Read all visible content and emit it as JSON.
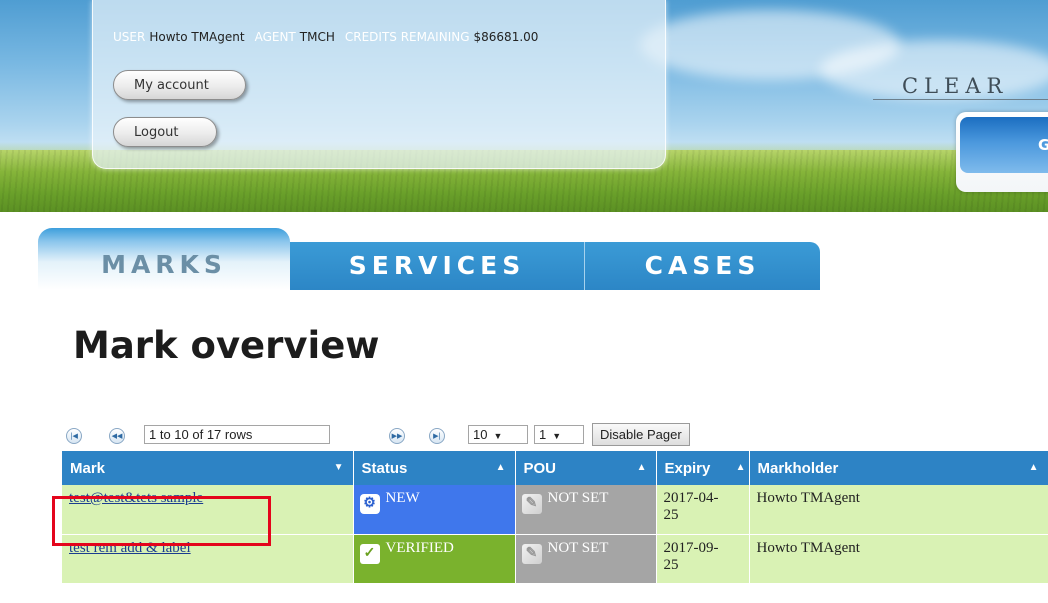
{
  "header": {
    "user_label": "USER",
    "user_value": "Howto TMAgent",
    "agent_label": "AGENT",
    "agent_value": "TMCH",
    "credits_label": "CREDITS REMAINING",
    "credits_value": "$86681.00",
    "my_account_label": "My account",
    "logout_label": "Logout",
    "brand_text": "CLEAR",
    "corner_button_label": "G"
  },
  "tabs": [
    {
      "label": "MARKS",
      "active": true
    },
    {
      "label": "SERVICES",
      "active": false
    },
    {
      "label": "CASES",
      "active": false
    }
  ],
  "page_title": "Mark overview",
  "pager": {
    "first_icon": "first-page-icon",
    "prev_icon": "previous-page-icon",
    "range_text": "1 to 10 of 17 rows",
    "next_icon": "next-page-icon",
    "last_icon": "last-page-icon",
    "page_size": "10",
    "page_number": "1",
    "disable_label": "Disable Pager"
  },
  "table": {
    "columns": [
      "Mark",
      "Status",
      "POU",
      "Expiry",
      "Markholder"
    ],
    "rows": [
      {
        "mark": "test@test&tets sample",
        "status": "NEW",
        "status_icon": "gear-icon",
        "pou": "NOT SET",
        "pou_icon": "pencil-icon",
        "expiry_line1": "2017-04-",
        "expiry_line2": "25",
        "markholder": "Howto TMAgent"
      },
      {
        "mark": "test rem add & label",
        "status": "VERIFIED",
        "status_icon": "check-icon",
        "pou": "NOT SET",
        "pou_icon": "pencil-icon",
        "expiry_line1": "2017-09-",
        "expiry_line2": "25",
        "markholder": "Howto TMAgent"
      }
    ]
  },
  "colors": {
    "tab_blue": "#2c86c6",
    "header_row": "#2d83c5",
    "row_green": "#d9f2b4",
    "status_new": "#3f77ec",
    "status_verified": "#7ab22d",
    "pou_grey": "#a5a5a5",
    "highlight_red": "#e4051c"
  }
}
